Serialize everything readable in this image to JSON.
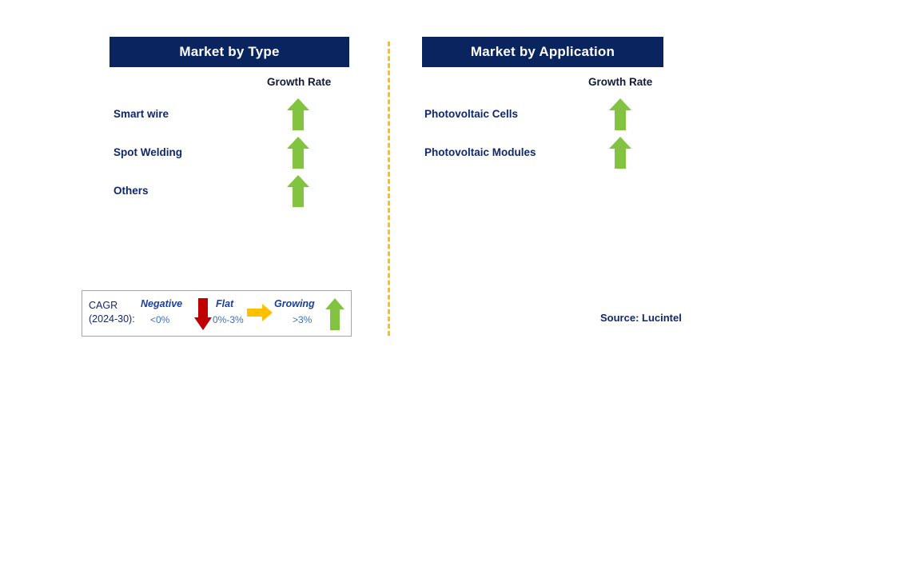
{
  "divider": {
    "icon": "dashed-vertical-divider",
    "color": "#ffc107"
  },
  "panels": [
    {
      "title": "Market by Type",
      "growth_rate_header": "Growth Rate",
      "rows": [
        {
          "label": "Smart wire",
          "growth": "Growing",
          "icon": "green-up-arrow-icon"
        },
        {
          "label": "Spot Welding",
          "growth": "Growing",
          "icon": "green-up-arrow-icon"
        },
        {
          "label": "Others",
          "growth": "Growing",
          "icon": "green-up-arrow-icon"
        }
      ]
    },
    {
      "title": "Market by Application",
      "growth_rate_header": "Growth Rate",
      "rows": [
        {
          "label": "Photovoltaic Cells",
          "growth": "Growing",
          "icon": "green-up-arrow-icon"
        },
        {
          "label": "Photovoltaic Modules",
          "growth": "Growing",
          "icon": "green-up-arrow-icon"
        }
      ]
    }
  ],
  "legend": {
    "cagr_line1": "CAGR",
    "cagr_line2": "(2024-30):",
    "items": [
      {
        "title": "Negative",
        "range": "<0%",
        "icon": "red-down-arrow-icon",
        "color": "#c00000"
      },
      {
        "title": "Flat",
        "range": "0%-3%",
        "icon": "amber-right-arrow-icon",
        "color": "#ffc000"
      },
      {
        "title": "Growing",
        "range": ">3%",
        "icon": "green-up-arrow-icon",
        "color": "#82c341"
      }
    ]
  },
  "source": "Source: Lucintel",
  "colors": {
    "header_bar": "#09245e",
    "label_text": "#11286b",
    "growing_green": "#82c341",
    "negative_red": "#c00000",
    "flat_amber": "#ffc000",
    "divider_amber": "#ffc107"
  },
  "chart_data": {
    "type": "table",
    "title": "Market Segments Growth Rate",
    "columns": [
      "Segment",
      "Growth Rate"
    ],
    "groups": [
      {
        "name": "Market by Type",
        "rows": [
          {
            "Segment": "Smart wire",
            "Growth Rate": "Growing (>3%)"
          },
          {
            "Segment": "Spot Welding",
            "Growth Rate": "Growing (>3%)"
          },
          {
            "Segment": "Others",
            "Growth Rate": "Growing (>3%)"
          }
        ]
      },
      {
        "name": "Market by Application",
        "rows": [
          {
            "Segment": "Photovoltaic Cells",
            "Growth Rate": "Growing (>3%)"
          },
          {
            "Segment": "Photovoltaic Modules",
            "Growth Rate": "Growing (>3%)"
          }
        ]
      }
    ],
    "legend": {
      "period": "CAGR (2024-30)",
      "bands": [
        {
          "name": "Negative",
          "range": "<0%"
        },
        {
          "name": "Flat",
          "range": "0%-3%"
        },
        {
          "name": "Growing",
          "range": ">3%"
        }
      ]
    },
    "source": "Lucintel"
  }
}
